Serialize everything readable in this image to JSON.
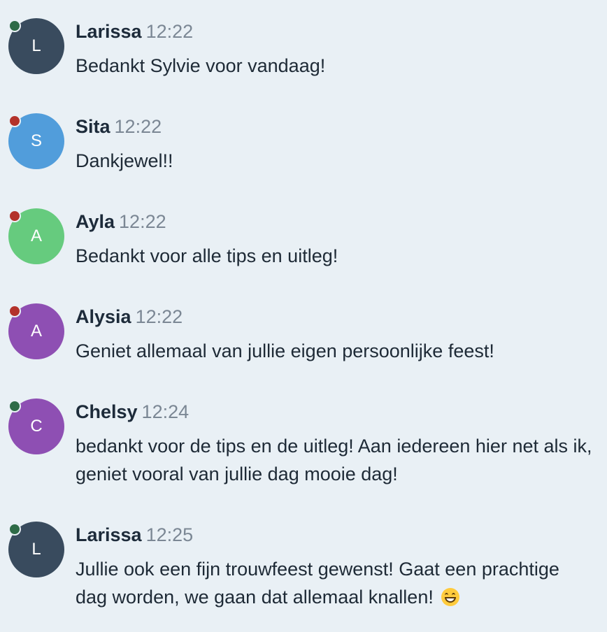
{
  "colors": {
    "background": "#e9f0f5",
    "online": "#2e6b47",
    "busy": "#b3322b"
  },
  "messages": [
    {
      "avatar_letter": "L",
      "avatar_color": "#394b5e",
      "status": "online",
      "name": "Larissa",
      "time": "12:22",
      "text": "Bedankt Sylvie voor vandaag!"
    },
    {
      "avatar_letter": "S",
      "avatar_color": "#519ddb",
      "status": "busy",
      "name": "Sita",
      "time": "12:22",
      "text": "Dankjewel!!"
    },
    {
      "avatar_letter": "A",
      "avatar_color": "#66cb7e",
      "status": "busy",
      "name": "Ayla",
      "time": "12:22",
      "text": "Bedankt voor alle tips en uitleg!"
    },
    {
      "avatar_letter": "A",
      "avatar_color": "#8e4fb3",
      "status": "busy",
      "name": "Alysia",
      "time": "12:22",
      "text": "Geniet allemaal van jullie eigen persoonlijke feest!"
    },
    {
      "avatar_letter": "C",
      "avatar_color": "#8e4fb3",
      "status": "online",
      "name": "Chelsy",
      "time": "12:24",
      "text": "bedankt voor de tips en de uitleg! Aan iedereen hier net als ik, geniet vooral van jullie dag mooie dag!"
    },
    {
      "avatar_letter": "L",
      "avatar_color": "#394b5e",
      "status": "online",
      "name": "Larissa",
      "time": "12:25",
      "text": "Jullie ook een fijn trouwfeest gewenst! Gaat een prachtige dag worden, we gaan dat allemaal knallen!",
      "emoji": "grinning-face-icon"
    }
  ]
}
